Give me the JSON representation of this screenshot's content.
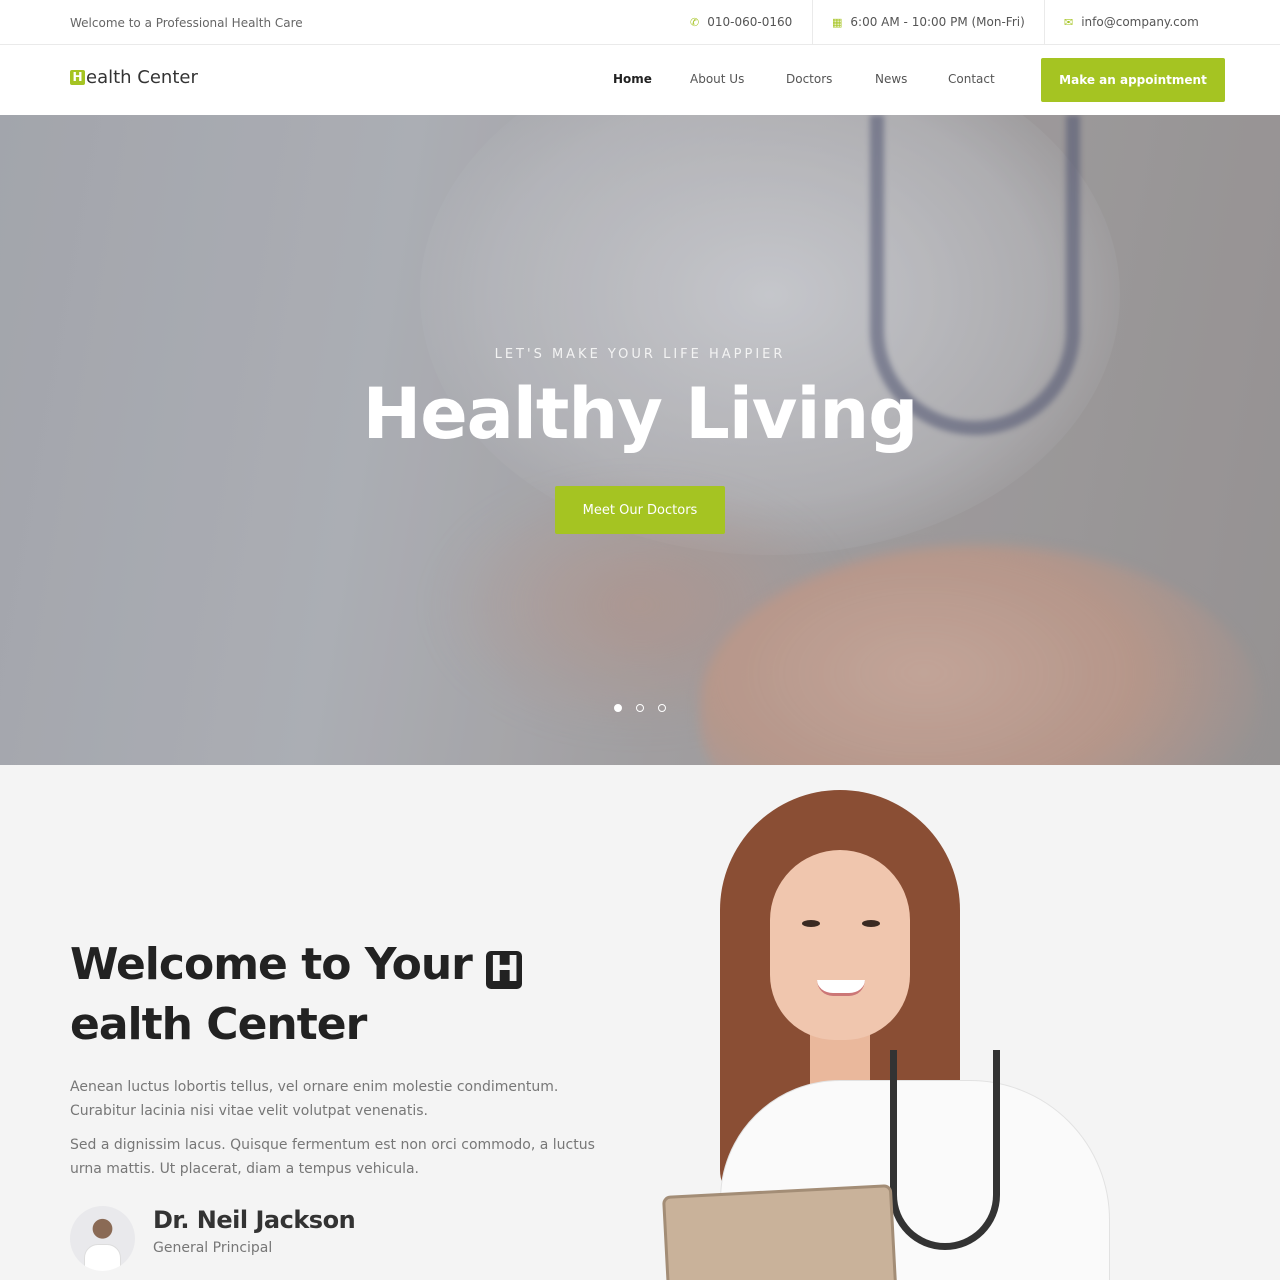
{
  "topbar": {
    "welcome": "Welcome to a Professional Health Care",
    "phone": "010-060-0160",
    "hours": "6:00 AM - 10:00 PM (Mon-Fri)",
    "email": "info@company.com"
  },
  "header": {
    "logo_letter": "H",
    "logo_rest": "ealth Center",
    "nav": [
      "Home",
      "About Us",
      "Doctors",
      "News",
      "Contact"
    ],
    "active_nav": "Home",
    "cta": "Make an appointment"
  },
  "hero": {
    "kicker": "LET'S MAKE YOUR LIFE HAPPIER",
    "title": "Healthy Living",
    "button": "Meet Our Doctors",
    "slides": 3,
    "active_slide": 1
  },
  "welcome": {
    "title_part1": "Welcome to Your ",
    "title_letter": "H",
    "title_part2": "ealth Center",
    "p1": "Aenean luctus lobortis tellus, vel ornare enim molestie condimentum. Curabitur lacinia nisi vitae velit volutpat venenatis.",
    "p2": "Sed a dignissim lacus. Quisque fermentum est non orci commodo, a luctus urna mattis. Ut placerat, diam a tempus vehicula.",
    "doctor_name": "Dr. Neil Jackson",
    "doctor_role": "General Principal"
  },
  "colors": {
    "accent": "#a5c422",
    "dark": "#222222",
    "section_bg": "#f4f4f4"
  },
  "icons": {
    "phone": "phone-icon",
    "hours": "calendar-icon",
    "email": "envelope-icon"
  }
}
